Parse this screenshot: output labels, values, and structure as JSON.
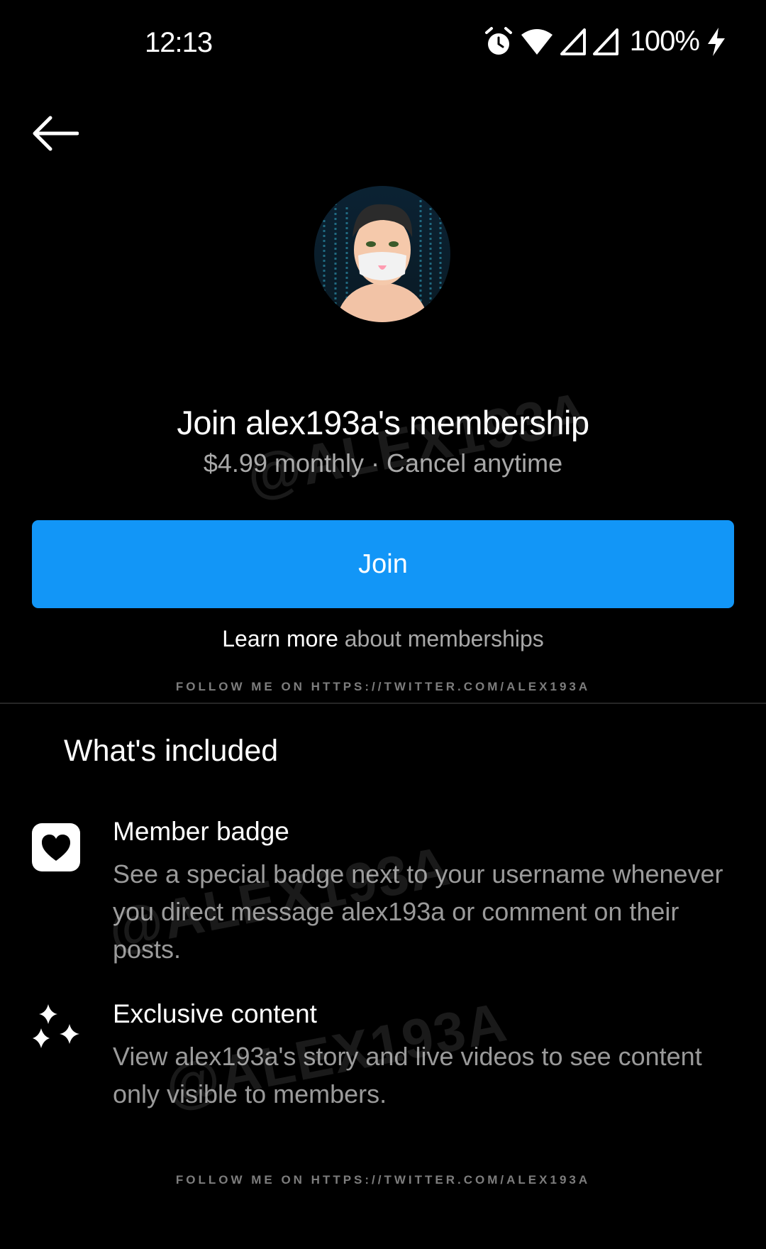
{
  "status_bar": {
    "time": "12:13",
    "battery": "100%",
    "icons": [
      "alarm-icon",
      "wifi-icon",
      "signal-icon",
      "signal-icon",
      "charging-icon"
    ]
  },
  "header": {
    "back_icon": "arrow-left-icon"
  },
  "membership": {
    "title": "Join alex193a's membership",
    "subtitle": "$4.99 monthly · Cancel anytime",
    "join_label": "Join",
    "learn_more_link": "Learn more",
    "learn_more_rest": " about memberships"
  },
  "watermark_text": "FOLLOW ME ON HTTPS://TWITTER.COM/ALEX193A",
  "overlay_watermark": "@ALEX193A",
  "included": {
    "title": "What's included",
    "items": [
      {
        "icon": "heart-badge-icon",
        "title": "Member badge",
        "description": "See a special badge next to your username whenever you direct message alex193a or comment on their posts."
      },
      {
        "icon": "sparkles-icon",
        "title": "Exclusive content",
        "description": "View alex193a's story and live videos to see content only visible to members."
      }
    ]
  },
  "colors": {
    "background": "#000000",
    "accent": "#1296f7",
    "secondary_text": "#a8a8a8"
  }
}
